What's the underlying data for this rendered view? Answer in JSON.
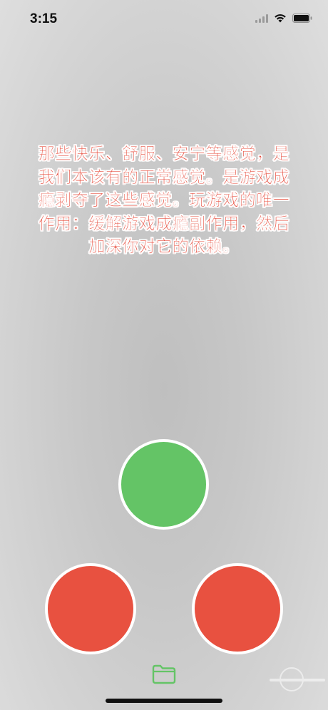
{
  "status_bar": {
    "time": "3:15",
    "icons": [
      "cellular-signal-icon",
      "wifi-icon",
      "battery-icon"
    ]
  },
  "quote": {
    "text": "那些快乐、舒服、安宁等感觉，是我们本该有的正常感觉。是游戏成瘾剥夺了这些感觉。玩游戏的唯一作用：缓解游戏成瘾副作用，然后加深你对它的依赖。",
    "color": "#e74c3c"
  },
  "buttons": {
    "green": {
      "color": "#64c466"
    },
    "red_left": {
      "color": "#e85140"
    },
    "red_right": {
      "color": "#e85140"
    }
  },
  "toolbar": {
    "folder_icon": "folder-icon",
    "icon_color": "#64c466"
  },
  "watermark": {
    "brand_logo": "pconline-logo"
  }
}
